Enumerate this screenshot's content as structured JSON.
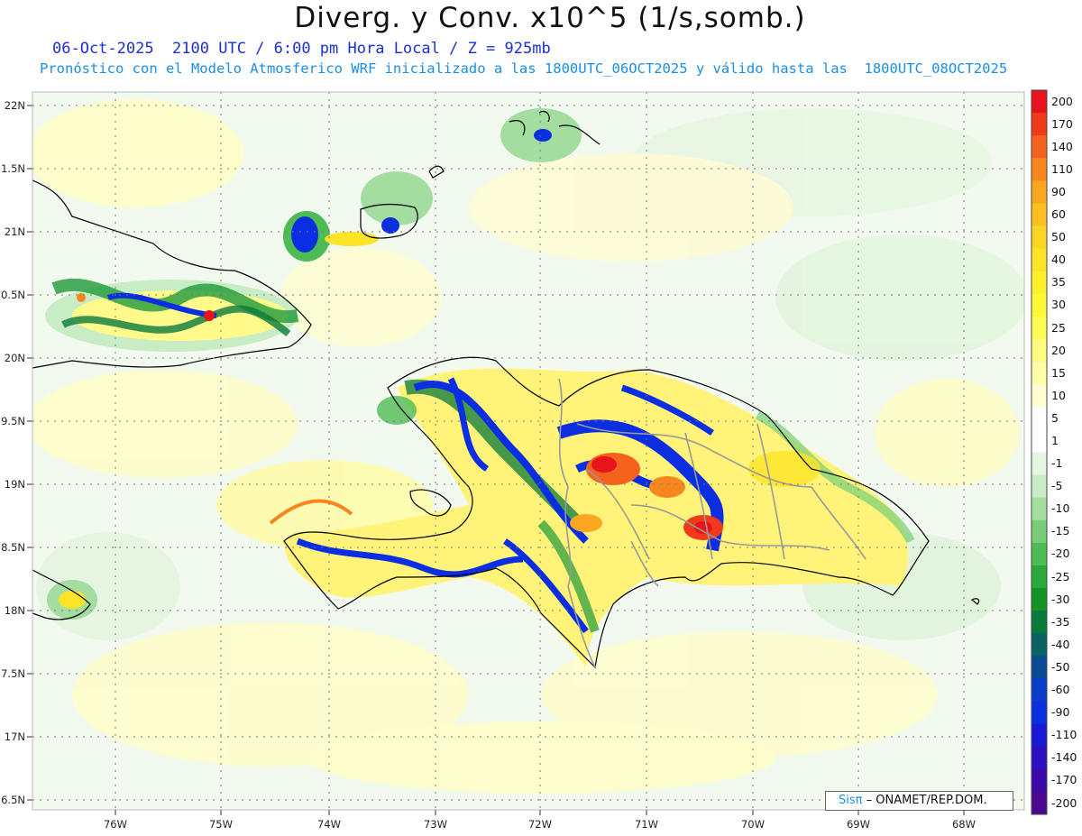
{
  "header": {
    "title": "Diverg. y Conv. x10^5 (1/s,somb.)",
    "valid_line": "06-Oct-2025  2100 UTC / 6:00 pm Hora Local / Z = 925mb",
    "model_line": "Pronóstico con el Modelo Atmosferico WRF inicializado a las 1800UTC_06OCT2025 y válido hasta las  1800UTC_08OCT2025"
  },
  "axes": {
    "lat_labels": [
      "22N",
      "1.5N",
      "21N",
      "0.5N",
      "20N",
      "9.5N",
      "19N",
      "8.5N",
      "18N",
      "7.5N",
      "17N",
      "6.5N"
    ],
    "lon_labels": [
      "76W",
      "75W",
      "74W",
      "73W",
      "72W",
      "71W",
      "70W",
      "69W",
      "68W"
    ]
  },
  "colorbar": {
    "labels": [
      "200",
      "170",
      "140",
      "110",
      "90",
      "60",
      "50",
      "40",
      "35",
      "30",
      "25",
      "20",
      "15",
      "10",
      "5",
      "1",
      "-1",
      "-5",
      "-10",
      "-15",
      "-20",
      "-25",
      "-30",
      "-35",
      "-40",
      "-50",
      "-60",
      "-90",
      "-110",
      "-140",
      "-170",
      "-200"
    ],
    "colors": [
      "#e8141c",
      "#f03a1c",
      "#f5621e",
      "#f8861f",
      "#faa620",
      "#fbbf22",
      "#fcd423",
      "#fde427",
      "#fef02c",
      "#fff837",
      "#fffb55",
      "#fffd80",
      "#fffea8",
      "#fefed0",
      "#ffffff",
      "#ffffff",
      "#e6f5e2",
      "#c8ecc3",
      "#a3dea0",
      "#78cd79",
      "#4fbb55",
      "#2ba83b",
      "#139526",
      "#0a7a3a",
      "#0b6262",
      "#0b4c94",
      "#0a3dc9",
      "#0a2ee0",
      "#1a1ad6",
      "#2a10c0",
      "#3a0aa8",
      "#4a0890"
    ]
  },
  "credit": {
    "logo_text": "Sisπ",
    "text": "– ONAMET/REP.DOM."
  }
}
